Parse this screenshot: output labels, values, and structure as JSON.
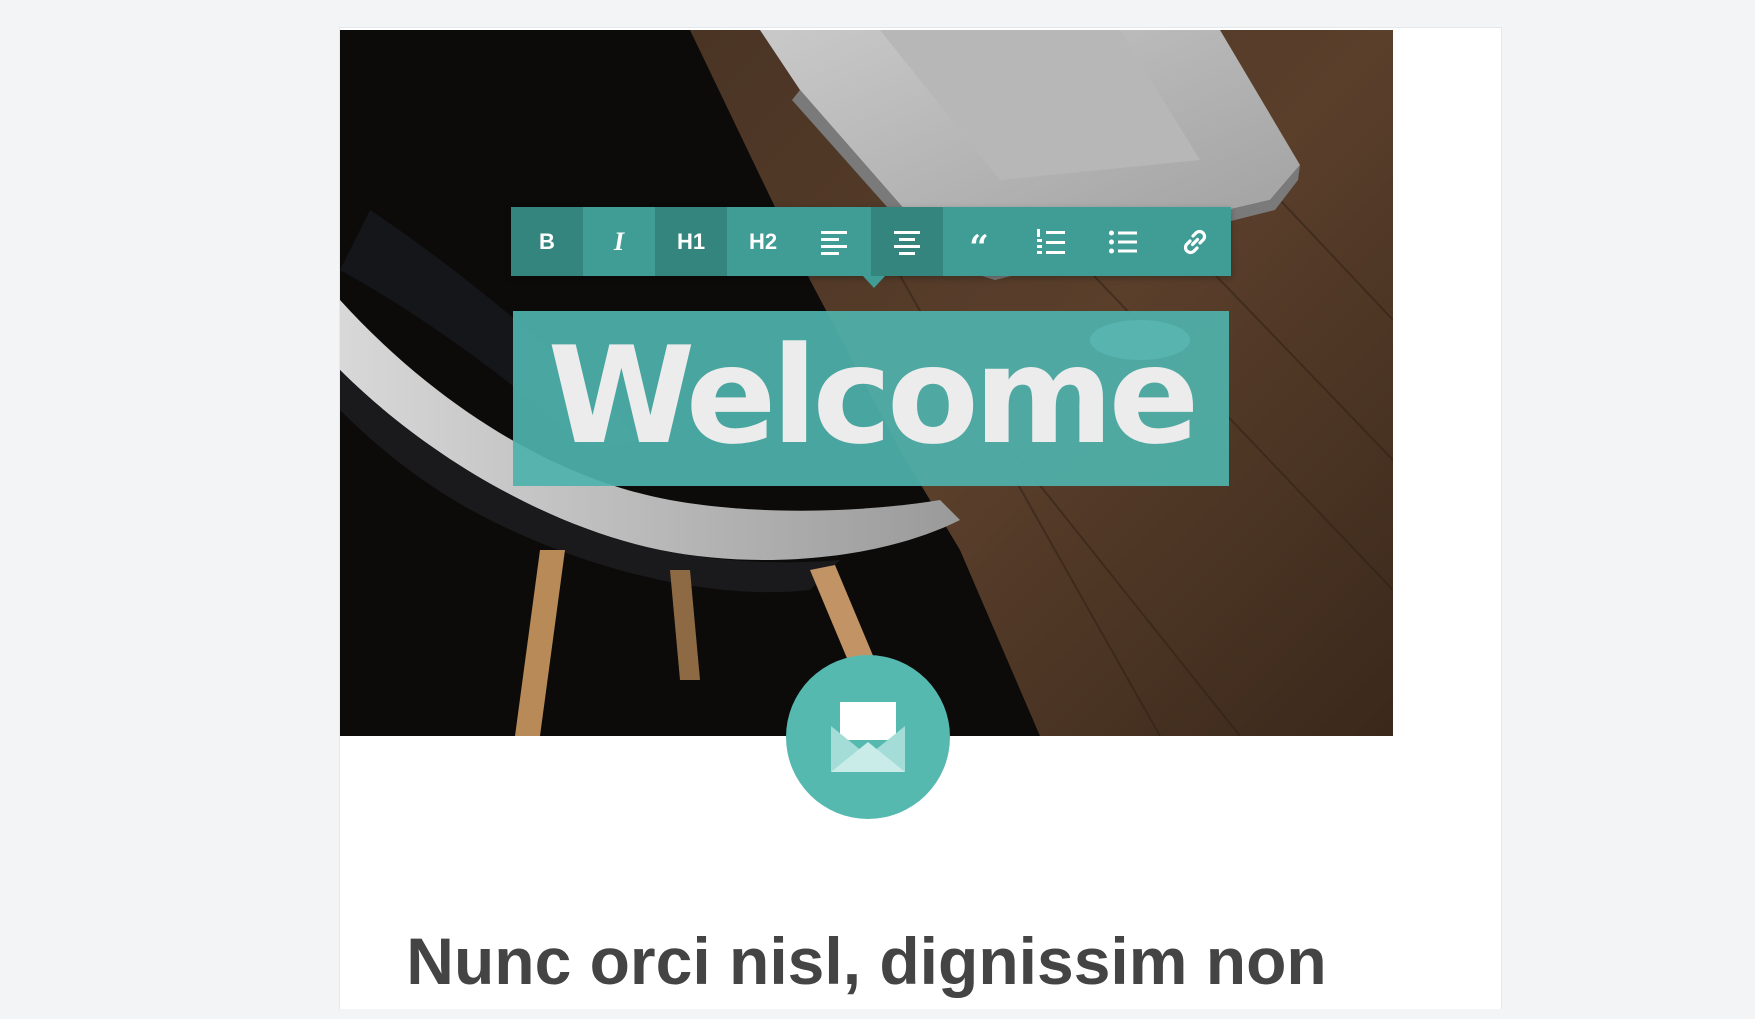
{
  "toolbar": {
    "buttons": [
      {
        "id": "bold",
        "label": "B",
        "icon": "bold-icon",
        "active": true
      },
      {
        "id": "italic",
        "label": "I",
        "icon": "italic-icon",
        "active": false
      },
      {
        "id": "h1",
        "label": "H1",
        "icon": "heading-1-icon",
        "active": true
      },
      {
        "id": "h2",
        "label": "H2",
        "icon": "heading-2-icon",
        "active": false
      },
      {
        "id": "align-left",
        "label": "",
        "icon": "align-left-icon",
        "active": false
      },
      {
        "id": "align-center",
        "label": "",
        "icon": "align-center-icon",
        "active": true
      },
      {
        "id": "quote",
        "label": "“",
        "icon": "quote-icon",
        "active": false
      },
      {
        "id": "ordered-list",
        "label": "",
        "icon": "ordered-list-icon",
        "active": false
      },
      {
        "id": "unordered-list",
        "label": "",
        "icon": "unordered-list-icon",
        "active": false
      },
      {
        "id": "link",
        "label": "",
        "icon": "link-icon",
        "active": false
      }
    ]
  },
  "hero": {
    "heading": "Welcome",
    "badge_icon": "envelope-icon"
  },
  "content": {
    "subheading": "Nunc orci nisl, dignissim non"
  },
  "colors": {
    "accent": "#3f9d96",
    "accent_active": "#35857f",
    "selection": "#4fb2ab",
    "badge": "#55b9b0",
    "page_background": "#f2f4f6",
    "text_dark": "#444444"
  }
}
